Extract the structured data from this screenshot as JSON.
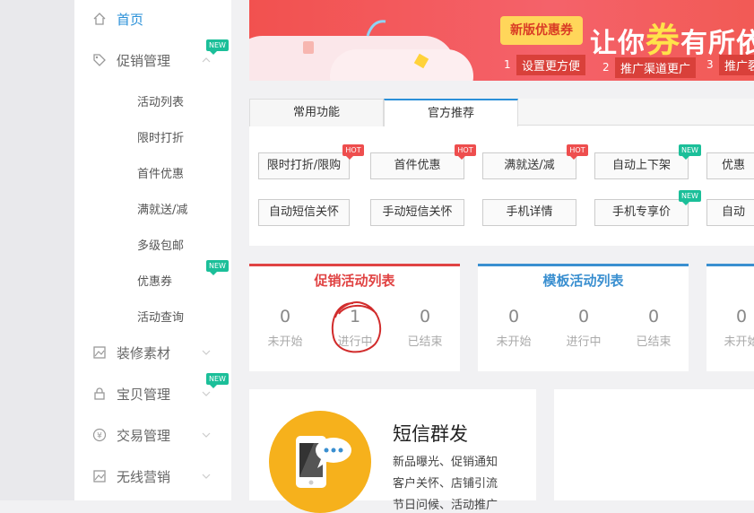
{
  "sidebar": {
    "home": "首页",
    "promotion": "促销管理",
    "promotion_items": [
      "活动列表",
      "限时打折",
      "首件优惠",
      "满就送/减",
      "多级包邮",
      "优惠券",
      "活动查询"
    ],
    "decoration": "装修素材",
    "items": "宝贝管理",
    "trade": "交易管理",
    "wireless": "无线营销",
    "new_tag": "NEW"
  },
  "banner": {
    "badge": "新版优惠券",
    "title_a": "让你",
    "title_b": "券",
    "title_c": "有所依",
    "steps": [
      {
        "num": "1",
        "text": "设置更方便"
      },
      {
        "num": "2",
        "text": "推广渠道更广"
      },
      {
        "num": "3",
        "text": "推广裂"
      }
    ]
  },
  "tabs": {
    "common": "常用功能",
    "official": "官方推荐"
  },
  "features": {
    "row1": [
      "限时打折/限购",
      "首件优惠",
      "满就送/减",
      "自动上下架",
      "优惠"
    ],
    "row2": [
      "自动短信关怀",
      "手动短信关怀",
      "手机详情",
      "手机专享价",
      "自动"
    ],
    "hot_tag": "HOT",
    "new_tag": "NEW"
  },
  "cards": [
    {
      "title": "促销活动列表",
      "color": "#e04343",
      "stats": [
        {
          "n": "0",
          "l": "未开始"
        },
        {
          "n": "1",
          "l": "进行中"
        },
        {
          "n": "0",
          "l": "已结束"
        }
      ]
    },
    {
      "title": "模板活动列表",
      "color": "#3a8fd0",
      "stats": [
        {
          "n": "0",
          "l": "未开始"
        },
        {
          "n": "0",
          "l": "进行中"
        },
        {
          "n": "0",
          "l": "已结束"
        }
      ]
    },
    {
      "title": "",
      "color": "#3a8fd0",
      "stats": [
        {
          "n": "0",
          "l": "未开始"
        }
      ]
    }
  ],
  "sms": {
    "title": "短信群发",
    "line1": "新品曝光、促销通知",
    "line2": "客户关怀、店铺引流",
    "line3": "节日问候、活动推广"
  },
  "colors": {
    "accent": "#2a90d8",
    "hot": "#ee4e4e",
    "new": "#1bbf99",
    "banner": "#f2514f"
  }
}
